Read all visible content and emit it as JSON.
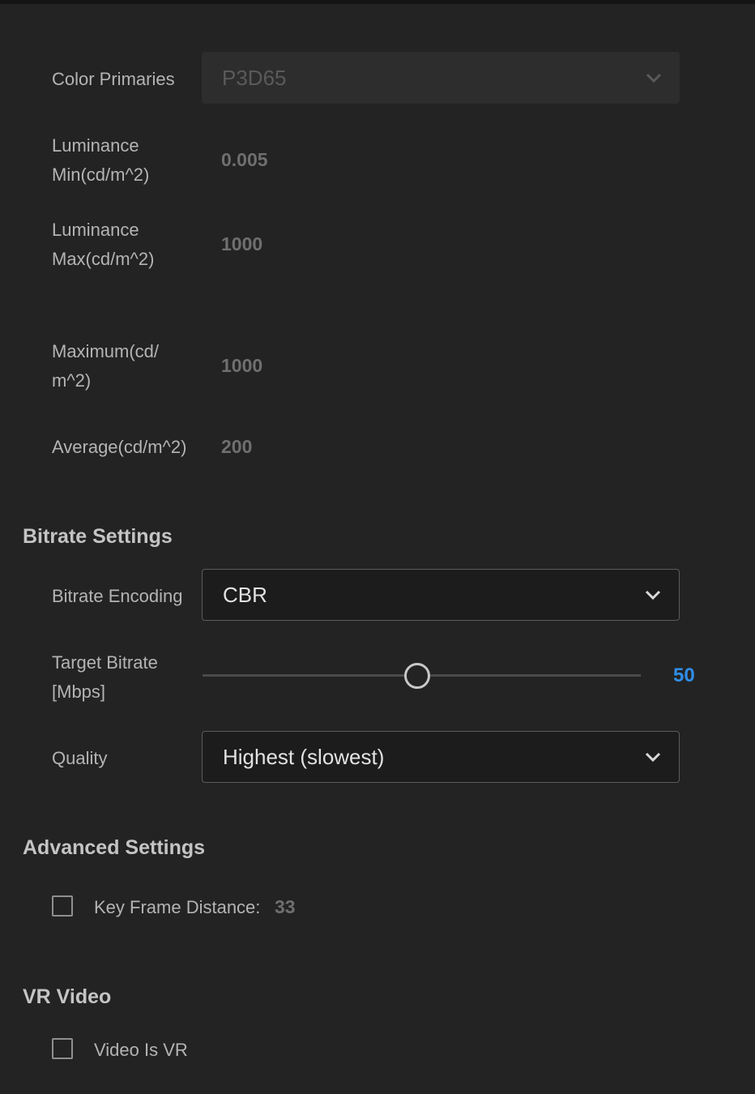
{
  "hdr": {
    "color_primaries_label": "Color Primaries",
    "color_primaries_value": "P3D65",
    "lum_min_label_1": "Luminance",
    "lum_min_label_2": "Min(cd/m^2)",
    "lum_min_value": "0.005",
    "lum_max_label_1": "Luminance",
    "lum_max_label_2": "Max(cd/m^2)",
    "lum_max_value": "1000",
    "max_label_1": "Maximum(cd/",
    "max_label_2": "m^2)",
    "max_value": "1000",
    "avg_label": "Average(cd/m^2)",
    "avg_value": "200"
  },
  "bitrate": {
    "section_title": "Bitrate Settings",
    "encoding_label": "Bitrate Encoding",
    "encoding_value": "CBR",
    "target_label_1": "Target Bitrate",
    "target_label_2": "[Mbps]",
    "target_value": "50",
    "target_fraction": 0.49,
    "quality_label": "Quality",
    "quality_value": "Highest (slowest)"
  },
  "advanced": {
    "section_title": "Advanced Settings",
    "keyframe_label": "Key Frame Distance:",
    "keyframe_value": "33",
    "keyframe_checked": false
  },
  "vr": {
    "section_title": "VR Video",
    "video_is_vr_label": "Video Is VR",
    "video_is_vr_checked": false
  },
  "colors": {
    "background": "#232323",
    "accent": "#2f8ee8"
  },
  "icons": {
    "dropdown": "chevron-down-icon"
  }
}
